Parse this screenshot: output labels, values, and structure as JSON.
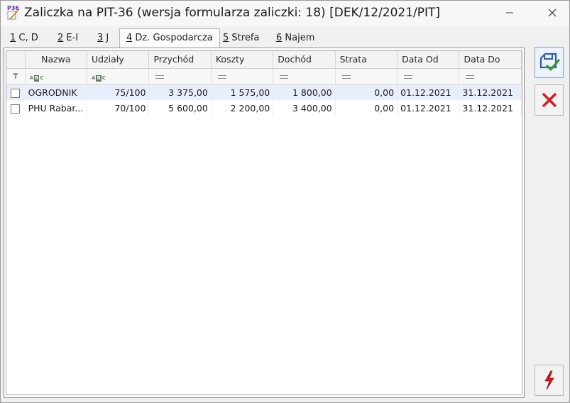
{
  "window": {
    "icon_text": "P36",
    "title": "Zaliczka na PIT-36 (wersja formularza zaliczki: 18) [DEK/12/2021/PIT]"
  },
  "tabs": [
    {
      "key": "1",
      "label": " C, D",
      "active": false
    },
    {
      "key": "2",
      "label": " E-I",
      "active": false
    },
    {
      "key": "3",
      "label": " J",
      "active": false
    },
    {
      "key": "4",
      "label": " Dz. Gospodarcza",
      "active": true
    },
    {
      "key": "5",
      "label": " Strefa",
      "active": false
    },
    {
      "key": "6",
      "label": " Najem",
      "active": false
    }
  ],
  "grid": {
    "columns": [
      "Nazwa",
      "Udziały",
      "Przychód",
      "Koszty",
      "Dochód",
      "Strata",
      "Data Od",
      "Data Do"
    ],
    "filter_icons": [
      "abc-filter-icon",
      "abc-filter-icon",
      "equals-filter-icon",
      "equals-filter-icon",
      "equals-filter-icon",
      "equals-filter-icon",
      "equals-filter-icon",
      "equals-filter-icon"
    ],
    "rows": [
      {
        "checked": false,
        "selected": true,
        "cells": [
          "OGRODNIK",
          "75/100",
          "3 375,00",
          "1 575,00",
          "1 800,00",
          "0,00",
          "01.12.2021",
          "31.12.2021"
        ]
      },
      {
        "checked": false,
        "selected": false,
        "cells": [
          "PHU Rabar...",
          "70/100",
          "5 600,00",
          "2 200,00",
          "3 400,00",
          "0,00",
          "01.12.2021",
          "31.12.2021"
        ]
      }
    ]
  },
  "colors": {
    "selected_row": "#e8eefb",
    "save_icon": "#2b5fb3",
    "check_green": "#3a9a2e",
    "cancel_red": "#d8191b",
    "run_red": "#d8191b"
  },
  "side_buttons": [
    "save-icon",
    "cancel-icon",
    "lightning-icon"
  ]
}
